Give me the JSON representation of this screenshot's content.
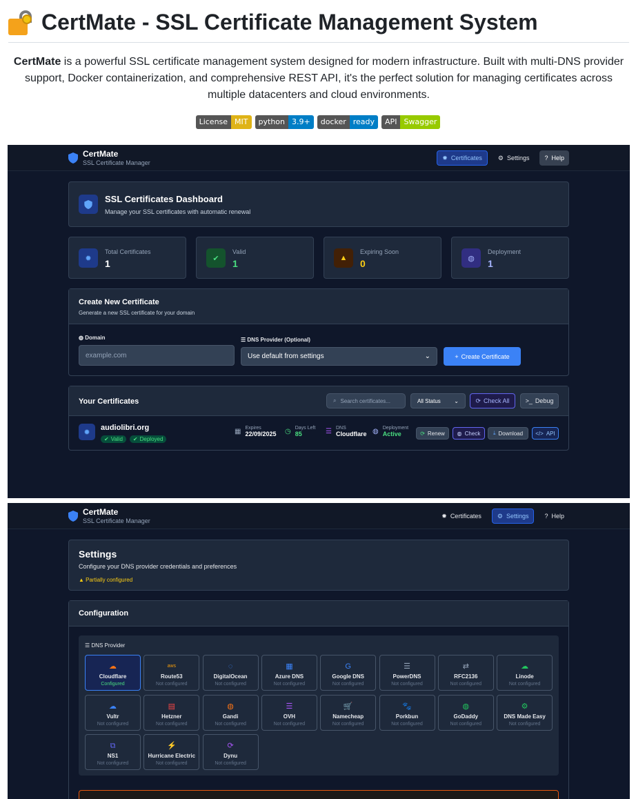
{
  "readme": {
    "title": "CertMate - SSL Certificate Management System",
    "intro_bold": "CertMate",
    "intro_line1": " is a powerful SSL certificate management system designed for modern infrastructure. Built with multi-DNS provider",
    "intro_line2": "support, Docker containerization, and comprehensive REST API, it's the perfect solution for managing certificates across",
    "intro_line3": "multiple datacenters and cloud environments.",
    "badges": [
      {
        "left": "License",
        "right": "MIT",
        "color": "#dfb317"
      },
      {
        "left": "python",
        "right": "3.9+",
        "color": "#007ec6"
      },
      {
        "left": "docker",
        "right": "ready",
        "color": "#007ec6"
      },
      {
        "left": "API",
        "right": "Swagger",
        "color": "#97ca00"
      }
    ]
  },
  "nav": {
    "brand_title": "CertMate",
    "brand_sub": "SSL Certificate Manager",
    "certificates": "Certificates",
    "settings": "Settings",
    "help": "Help"
  },
  "dashboard": {
    "title": "SSL Certificates Dashboard",
    "subtitle": "Manage your SSL certificates with automatic renewal",
    "stats": [
      {
        "label": "Total Certificates",
        "value": "1",
        "color": "#ffffff"
      },
      {
        "label": "Valid",
        "value": "1",
        "color": "#4ade80"
      },
      {
        "label": "Expiring Soon",
        "value": "0",
        "color": "#facc15"
      },
      {
        "label": "Deployment",
        "value": "1",
        "color": "#a5b4fc"
      }
    ],
    "create": {
      "title": "Create New Certificate",
      "subtitle": "Generate a new SSL certificate for your domain",
      "domain_label": "Domain",
      "domain_placeholder": "example.com",
      "dns_label": "DNS Provider (Optional)",
      "dns_value": "Use default from settings",
      "button": "Create Certificate"
    },
    "list": {
      "title": "Your Certificates",
      "search_placeholder": "Search certificates...",
      "status_filter": "All Status",
      "check_all": "Check All",
      "debug": "Debug"
    },
    "cert": {
      "domain": "audiolibri.org",
      "valid": "Valid",
      "deployed": "Deployed",
      "expires_label": "Expires",
      "expires_value": "22/09/2025",
      "days_label": "Days Left",
      "days_value": "85",
      "dns_label": "DNS",
      "dns_value": "Cloudflare",
      "deploy_label": "Deployment",
      "deploy_value": "Active",
      "renew": "Renew",
      "check": "Check",
      "download": "Download",
      "api": "API"
    }
  },
  "settings": {
    "title": "Settings",
    "subtitle": "Configure your DNS provider credentials and preferences",
    "status": "Partially configured",
    "config_title": "Configuration",
    "dns_section": "DNS Provider",
    "providers": [
      {
        "name": "Cloudflare",
        "status": "Configured",
        "icon": "☁",
        "color": "#f97316"
      },
      {
        "name": "Route53",
        "status": "Not configured",
        "icon": "aws",
        "color": "#f59e0b"
      },
      {
        "name": "DigitalOcean",
        "status": "Not configured",
        "icon": "◌",
        "color": "#3b82f6"
      },
      {
        "name": "Azure DNS",
        "status": "Not configured",
        "icon": "▦",
        "color": "#3b82f6"
      },
      {
        "name": "Google DNS",
        "status": "Not configured",
        "icon": "G",
        "color": "#3b82f6"
      },
      {
        "name": "PowerDNS",
        "status": "Not configured",
        "icon": "☰",
        "color": "#94a3b8"
      },
      {
        "name": "RFC2136",
        "status": "Not configured",
        "icon": "⇄",
        "color": "#94a3b8"
      },
      {
        "name": "Linode",
        "status": "Not configured",
        "icon": "☁",
        "color": "#22c55e"
      },
      {
        "name": "Vultr",
        "status": "Not configured",
        "icon": "☁",
        "color": "#3b82f6"
      },
      {
        "name": "Hetzner",
        "status": "Not configured",
        "icon": "▤",
        "color": "#ef4444"
      },
      {
        "name": "Gandi",
        "status": "Not configured",
        "icon": "◍",
        "color": "#f97316"
      },
      {
        "name": "OVH",
        "status": "Not configured",
        "icon": "☰",
        "color": "#a855f7"
      },
      {
        "name": "Namecheap",
        "status": "Not configured",
        "icon": "🛒",
        "color": "#ef4444"
      },
      {
        "name": "Porkbun",
        "status": "Not configured",
        "icon": "🐾",
        "color": "#ec4899"
      },
      {
        "name": "GoDaddy",
        "status": "Not configured",
        "icon": "◍",
        "color": "#22c55e"
      },
      {
        "name": "DNS Made Easy",
        "status": "Not configured",
        "icon": "⚙",
        "color": "#22c55e"
      },
      {
        "name": "NS1",
        "status": "Not configured",
        "icon": "⧉",
        "color": "#6366f1"
      },
      {
        "name": "Hurricane Electric",
        "status": "Not configured",
        "icon": "⚡",
        "color": "#facc15"
      },
      {
        "name": "Dynu",
        "status": "Not configured",
        "icon": "⟳",
        "color": "#a855f7"
      }
    ]
  }
}
